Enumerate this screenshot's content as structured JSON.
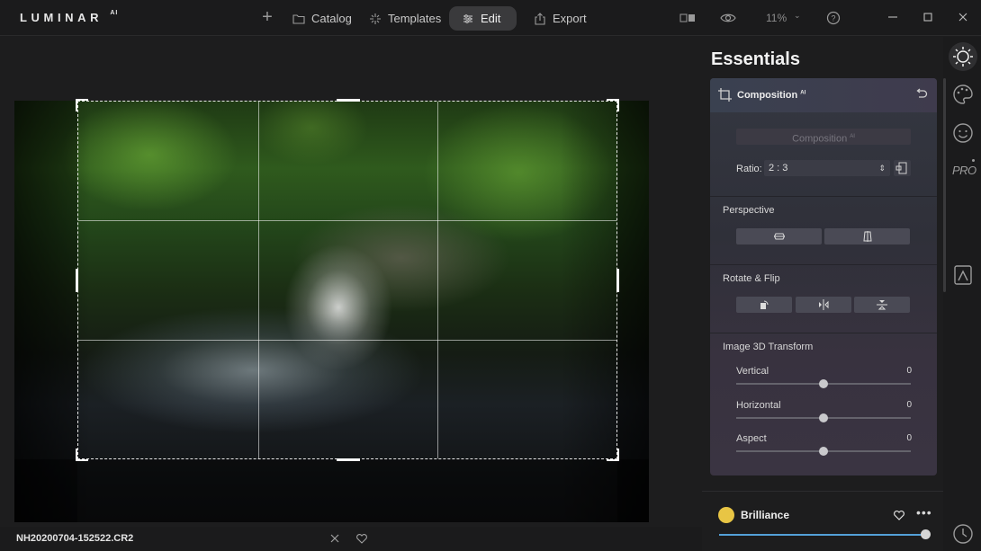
{
  "app": {
    "logo": "LUMINAR",
    "logo_sup": "AI"
  },
  "topbar": {
    "add_icon": "plus-icon",
    "catalog": "Catalog",
    "templates": "Templates",
    "edit": "Edit",
    "export": "Export",
    "zoom": "11%"
  },
  "canvas": {
    "filename": "NH20200704-152522.CR2"
  },
  "panel": {
    "title": "Essentials",
    "composition": {
      "title": "Composition",
      "title_sup": "AI",
      "button": "Composition",
      "button_sup": "AI",
      "ratio_label": "Ratio:",
      "ratio_value": "2 : 3"
    },
    "perspective": {
      "label": "Perspective"
    },
    "rotate_flip": {
      "label": "Rotate & Flip"
    },
    "transform3d": {
      "label": "Image 3D Transform",
      "sliders": [
        {
          "label": "Vertical",
          "value": "0",
          "position": 0.5
        },
        {
          "label": "Horizontal",
          "value": "0",
          "position": 0.5
        },
        {
          "label": "Aspect",
          "value": "0",
          "position": 0.5
        }
      ]
    },
    "brilliance": {
      "label": "Brilliance",
      "more": "•••",
      "position": 1.0
    }
  },
  "colors": {
    "accent_blue": "#54a0d8",
    "brilliance_icon": "#e8c544",
    "panel_card": "#343741"
  }
}
